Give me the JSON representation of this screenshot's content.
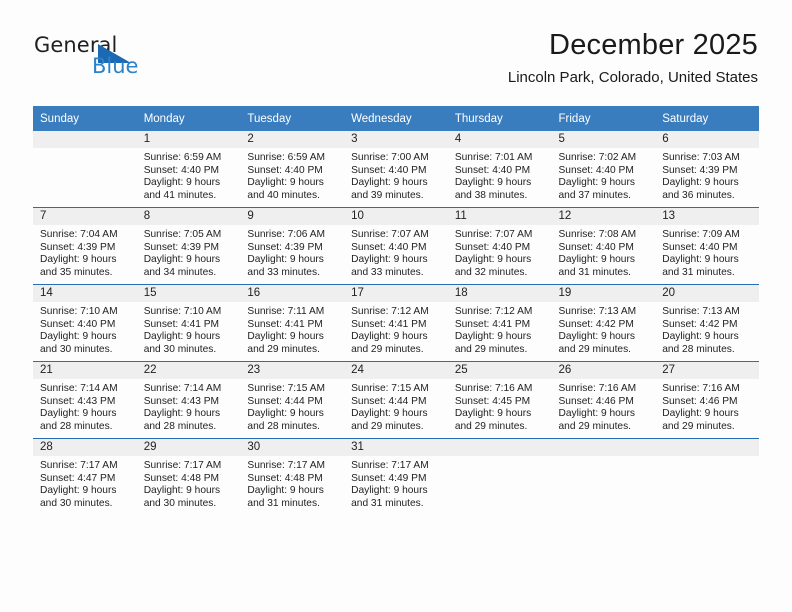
{
  "logo": {
    "text_top": "General",
    "text_bottom": "Blue",
    "triangle_color": "#1b68b3",
    "blue_color": "#2e82c8",
    "dark_color": "#231f20"
  },
  "header": {
    "month_title": "December 2025",
    "location": "Lincoln Park, Colorado, United States"
  },
  "theme": {
    "header_blue": "#3a7dbf",
    "row_divider_blue": "#2a6db5",
    "daynum_band": "#efefef",
    "page_background": "#fdfdfd"
  },
  "calendar": {
    "weekday_headers": [
      "Sunday",
      "Monday",
      "Tuesday",
      "Wednesday",
      "Thursday",
      "Friday",
      "Saturday"
    ],
    "weeks": [
      [
        {
          "day": "",
          "sunrise": "",
          "sunset": "",
          "daylight_1": "",
          "daylight_2": ""
        },
        {
          "day": "1",
          "sunrise": "Sunrise: 6:59 AM",
          "sunset": "Sunset: 4:40 PM",
          "daylight_1": "Daylight: 9 hours",
          "daylight_2": "and 41 minutes."
        },
        {
          "day": "2",
          "sunrise": "Sunrise: 6:59 AM",
          "sunset": "Sunset: 4:40 PM",
          "daylight_1": "Daylight: 9 hours",
          "daylight_2": "and 40 minutes."
        },
        {
          "day": "3",
          "sunrise": "Sunrise: 7:00 AM",
          "sunset": "Sunset: 4:40 PM",
          "daylight_1": "Daylight: 9 hours",
          "daylight_2": "and 39 minutes."
        },
        {
          "day": "4",
          "sunrise": "Sunrise: 7:01 AM",
          "sunset": "Sunset: 4:40 PM",
          "daylight_1": "Daylight: 9 hours",
          "daylight_2": "and 38 minutes."
        },
        {
          "day": "5",
          "sunrise": "Sunrise: 7:02 AM",
          "sunset": "Sunset: 4:40 PM",
          "daylight_1": "Daylight: 9 hours",
          "daylight_2": "and 37 minutes."
        },
        {
          "day": "6",
          "sunrise": "Sunrise: 7:03 AM",
          "sunset": "Sunset: 4:39 PM",
          "daylight_1": "Daylight: 9 hours",
          "daylight_2": "and 36 minutes."
        }
      ],
      [
        {
          "day": "7",
          "sunrise": "Sunrise: 7:04 AM",
          "sunset": "Sunset: 4:39 PM",
          "daylight_1": "Daylight: 9 hours",
          "daylight_2": "and 35 minutes."
        },
        {
          "day": "8",
          "sunrise": "Sunrise: 7:05 AM",
          "sunset": "Sunset: 4:39 PM",
          "daylight_1": "Daylight: 9 hours",
          "daylight_2": "and 34 minutes."
        },
        {
          "day": "9",
          "sunrise": "Sunrise: 7:06 AM",
          "sunset": "Sunset: 4:39 PM",
          "daylight_1": "Daylight: 9 hours",
          "daylight_2": "and 33 minutes."
        },
        {
          "day": "10",
          "sunrise": "Sunrise: 7:07 AM",
          "sunset": "Sunset: 4:40 PM",
          "daylight_1": "Daylight: 9 hours",
          "daylight_2": "and 33 minutes."
        },
        {
          "day": "11",
          "sunrise": "Sunrise: 7:07 AM",
          "sunset": "Sunset: 4:40 PM",
          "daylight_1": "Daylight: 9 hours",
          "daylight_2": "and 32 minutes."
        },
        {
          "day": "12",
          "sunrise": "Sunrise: 7:08 AM",
          "sunset": "Sunset: 4:40 PM",
          "daylight_1": "Daylight: 9 hours",
          "daylight_2": "and 31 minutes."
        },
        {
          "day": "13",
          "sunrise": "Sunrise: 7:09 AM",
          "sunset": "Sunset: 4:40 PM",
          "daylight_1": "Daylight: 9 hours",
          "daylight_2": "and 31 minutes."
        }
      ],
      [
        {
          "day": "14",
          "sunrise": "Sunrise: 7:10 AM",
          "sunset": "Sunset: 4:40 PM",
          "daylight_1": "Daylight: 9 hours",
          "daylight_2": "and 30 minutes."
        },
        {
          "day": "15",
          "sunrise": "Sunrise: 7:10 AM",
          "sunset": "Sunset: 4:41 PM",
          "daylight_1": "Daylight: 9 hours",
          "daylight_2": "and 30 minutes."
        },
        {
          "day": "16",
          "sunrise": "Sunrise: 7:11 AM",
          "sunset": "Sunset: 4:41 PM",
          "daylight_1": "Daylight: 9 hours",
          "daylight_2": "and 29 minutes."
        },
        {
          "day": "17",
          "sunrise": "Sunrise: 7:12 AM",
          "sunset": "Sunset: 4:41 PM",
          "daylight_1": "Daylight: 9 hours",
          "daylight_2": "and 29 minutes."
        },
        {
          "day": "18",
          "sunrise": "Sunrise: 7:12 AM",
          "sunset": "Sunset: 4:41 PM",
          "daylight_1": "Daylight: 9 hours",
          "daylight_2": "and 29 minutes."
        },
        {
          "day": "19",
          "sunrise": "Sunrise: 7:13 AM",
          "sunset": "Sunset: 4:42 PM",
          "daylight_1": "Daylight: 9 hours",
          "daylight_2": "and 29 minutes."
        },
        {
          "day": "20",
          "sunrise": "Sunrise: 7:13 AM",
          "sunset": "Sunset: 4:42 PM",
          "daylight_1": "Daylight: 9 hours",
          "daylight_2": "and 28 minutes."
        }
      ],
      [
        {
          "day": "21",
          "sunrise": "Sunrise: 7:14 AM",
          "sunset": "Sunset: 4:43 PM",
          "daylight_1": "Daylight: 9 hours",
          "daylight_2": "and 28 minutes."
        },
        {
          "day": "22",
          "sunrise": "Sunrise: 7:14 AM",
          "sunset": "Sunset: 4:43 PM",
          "daylight_1": "Daylight: 9 hours",
          "daylight_2": "and 28 minutes."
        },
        {
          "day": "23",
          "sunrise": "Sunrise: 7:15 AM",
          "sunset": "Sunset: 4:44 PM",
          "daylight_1": "Daylight: 9 hours",
          "daylight_2": "and 28 minutes."
        },
        {
          "day": "24",
          "sunrise": "Sunrise: 7:15 AM",
          "sunset": "Sunset: 4:44 PM",
          "daylight_1": "Daylight: 9 hours",
          "daylight_2": "and 29 minutes."
        },
        {
          "day": "25",
          "sunrise": "Sunrise: 7:16 AM",
          "sunset": "Sunset: 4:45 PM",
          "daylight_1": "Daylight: 9 hours",
          "daylight_2": "and 29 minutes."
        },
        {
          "day": "26",
          "sunrise": "Sunrise: 7:16 AM",
          "sunset": "Sunset: 4:46 PM",
          "daylight_1": "Daylight: 9 hours",
          "daylight_2": "and 29 minutes."
        },
        {
          "day": "27",
          "sunrise": "Sunrise: 7:16 AM",
          "sunset": "Sunset: 4:46 PM",
          "daylight_1": "Daylight: 9 hours",
          "daylight_2": "and 29 minutes."
        }
      ],
      [
        {
          "day": "28",
          "sunrise": "Sunrise: 7:17 AM",
          "sunset": "Sunset: 4:47 PM",
          "daylight_1": "Daylight: 9 hours",
          "daylight_2": "and 30 minutes."
        },
        {
          "day": "29",
          "sunrise": "Sunrise: 7:17 AM",
          "sunset": "Sunset: 4:48 PM",
          "daylight_1": "Daylight: 9 hours",
          "daylight_2": "and 30 minutes."
        },
        {
          "day": "30",
          "sunrise": "Sunrise: 7:17 AM",
          "sunset": "Sunset: 4:48 PM",
          "daylight_1": "Daylight: 9 hours",
          "daylight_2": "and 31 minutes."
        },
        {
          "day": "31",
          "sunrise": "Sunrise: 7:17 AM",
          "sunset": "Sunset: 4:49 PM",
          "daylight_1": "Daylight: 9 hours",
          "daylight_2": "and 31 minutes."
        },
        {
          "day": "",
          "sunrise": "",
          "sunset": "",
          "daylight_1": "",
          "daylight_2": ""
        },
        {
          "day": "",
          "sunrise": "",
          "sunset": "",
          "daylight_1": "",
          "daylight_2": ""
        },
        {
          "day": "",
          "sunrise": "",
          "sunset": "",
          "daylight_1": "",
          "daylight_2": ""
        }
      ]
    ]
  }
}
